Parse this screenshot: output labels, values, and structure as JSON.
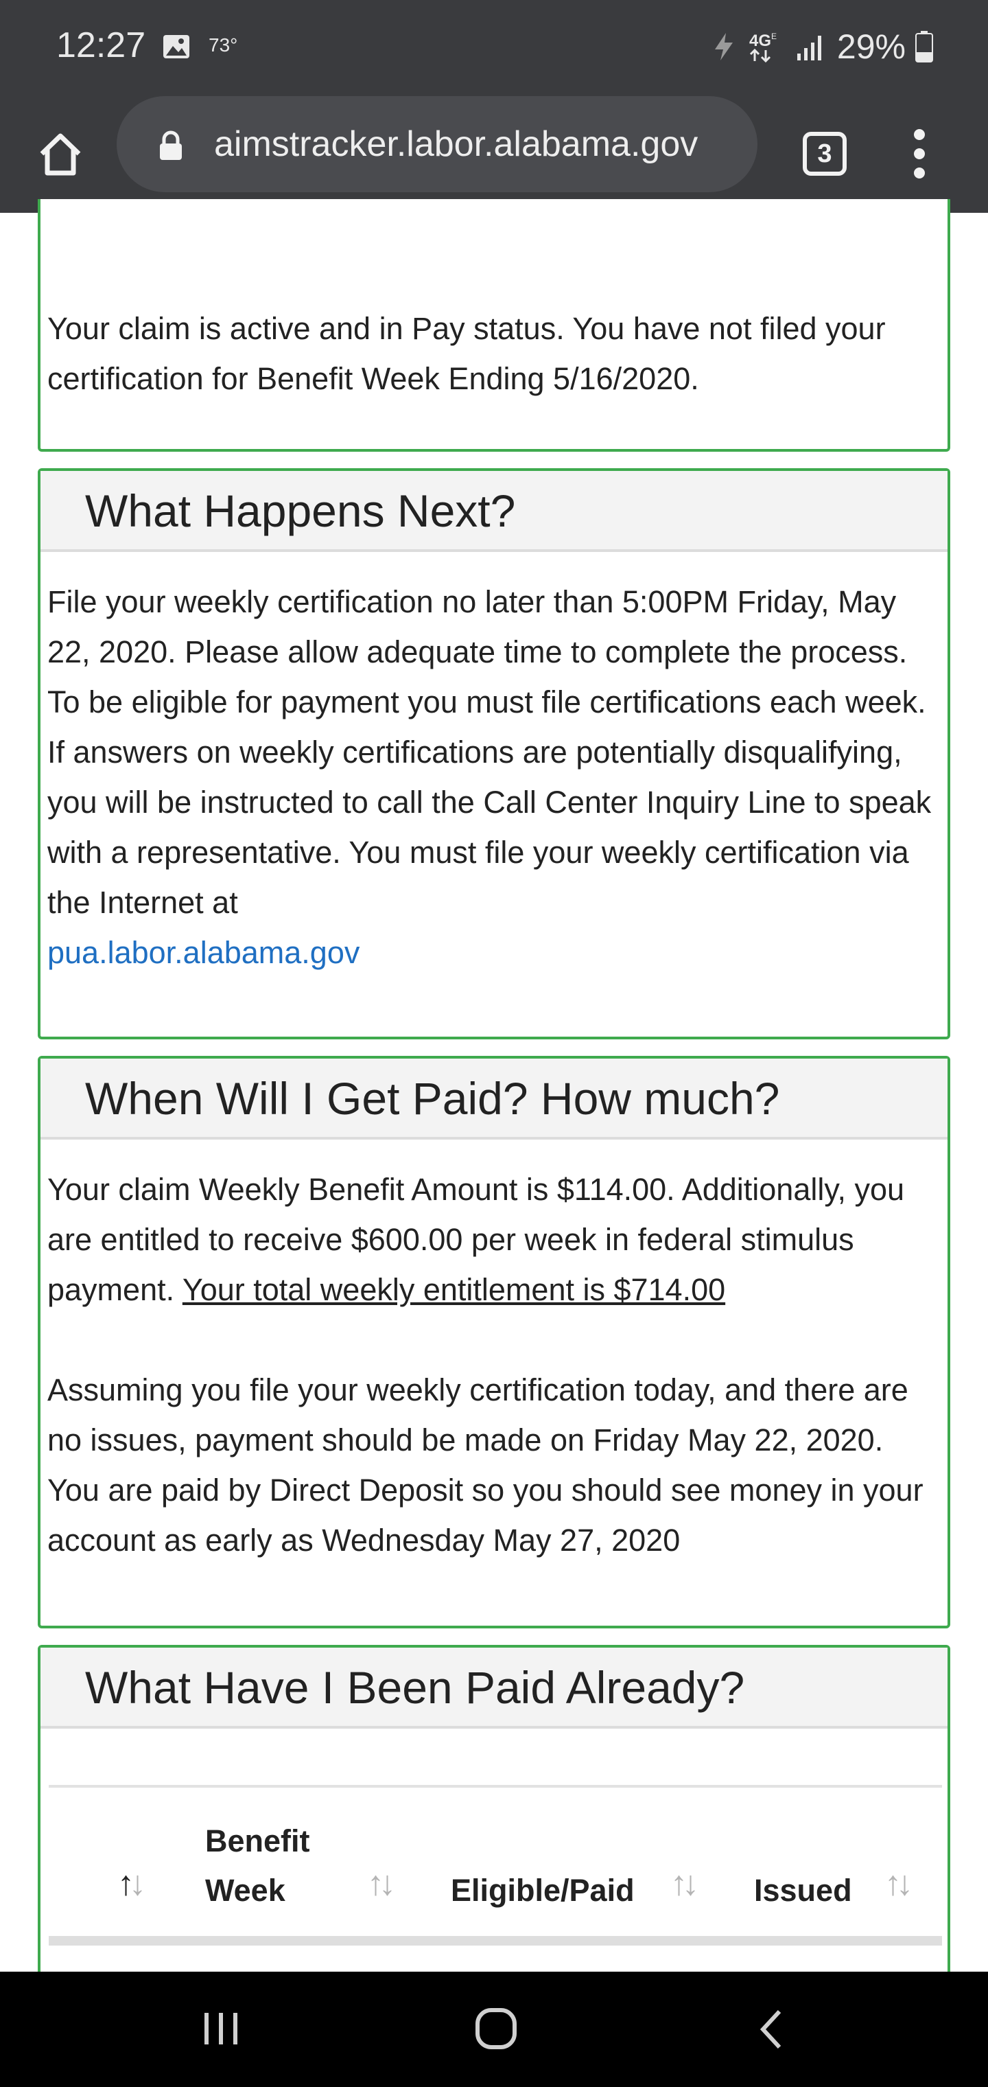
{
  "status_bar": {
    "time": "12:27",
    "temperature": "73°",
    "battery": "29%",
    "icons": [
      "image-icon",
      "bolt-icon",
      "network-4g-icon",
      "signal-icon",
      "battery-icon"
    ]
  },
  "browser": {
    "url": "aimstracker.labor.alabama.gov",
    "tab_count": "3",
    "icons": [
      "home-icon",
      "lock-icon",
      "tabs-icon",
      "more-vert-icon"
    ]
  },
  "status_card": {
    "text": "Your claim is active and in Pay status. You have not filed your certification for Benefit Week Ending 5/16/2020."
  },
  "next_card": {
    "title": "What Happens Next?",
    "text": "File your weekly certification no later than 5:00PM Friday, May 22, 2020. Please allow adequate time to complete the process. To be eligible for payment you must file certifications each week. If answers on weekly certifications are potentially disqualifying, you will be instructed to call the Call Center Inquiry Line to speak with a representative. You must file your weekly certification via the Internet at",
    "link": "pua.labor.alabama.gov"
  },
  "paid_card": {
    "title": "When Will I Get Paid? How much?",
    "para1": "Your claim Weekly Benefit Amount is $114.00. Additionally, you are entitled to receive $600.00 per week in federal stimulus payment.",
    "para1_underline": "Your total weekly entitlement is $714.00",
    "para2": "Assuming you file your weekly certification today, and there are no issues, payment should be made on Friday May 22, 2020. You are paid by Direct Deposit so you should see money in your account as early as Wednesday May 27, 2020"
  },
  "history_card": {
    "title": "What Have I Been Paid Already?",
    "columns": [
      "",
      "Benefit Week",
      "Eligible/Paid",
      "Issued"
    ]
  },
  "nav_bar": {
    "icons": [
      "recents-icon",
      "home-circle-icon",
      "back-icon"
    ]
  },
  "colors": {
    "card_border": "#3faa4e",
    "link": "#1f6fc2",
    "chrome_bar": "#3a3b3e"
  }
}
